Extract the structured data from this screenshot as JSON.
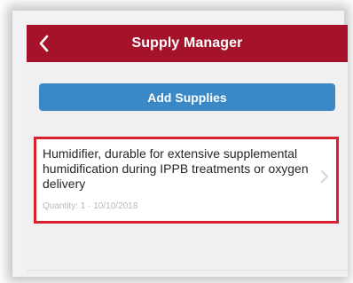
{
  "navbar": {
    "title": "Supply Manager",
    "back_icon": "chevron-left-icon",
    "color": "#a5132b"
  },
  "actions": {
    "add_label": "Add Supplies",
    "add_color": "#3a88c6"
  },
  "supplies": [
    {
      "name": "Humidifier, durable for extensive supplemental humidification during IPPB treatments or oxygen delivery",
      "meta": "Quantity: 1 · 10/10/2018",
      "highlight_color": "#d8202f"
    }
  ]
}
